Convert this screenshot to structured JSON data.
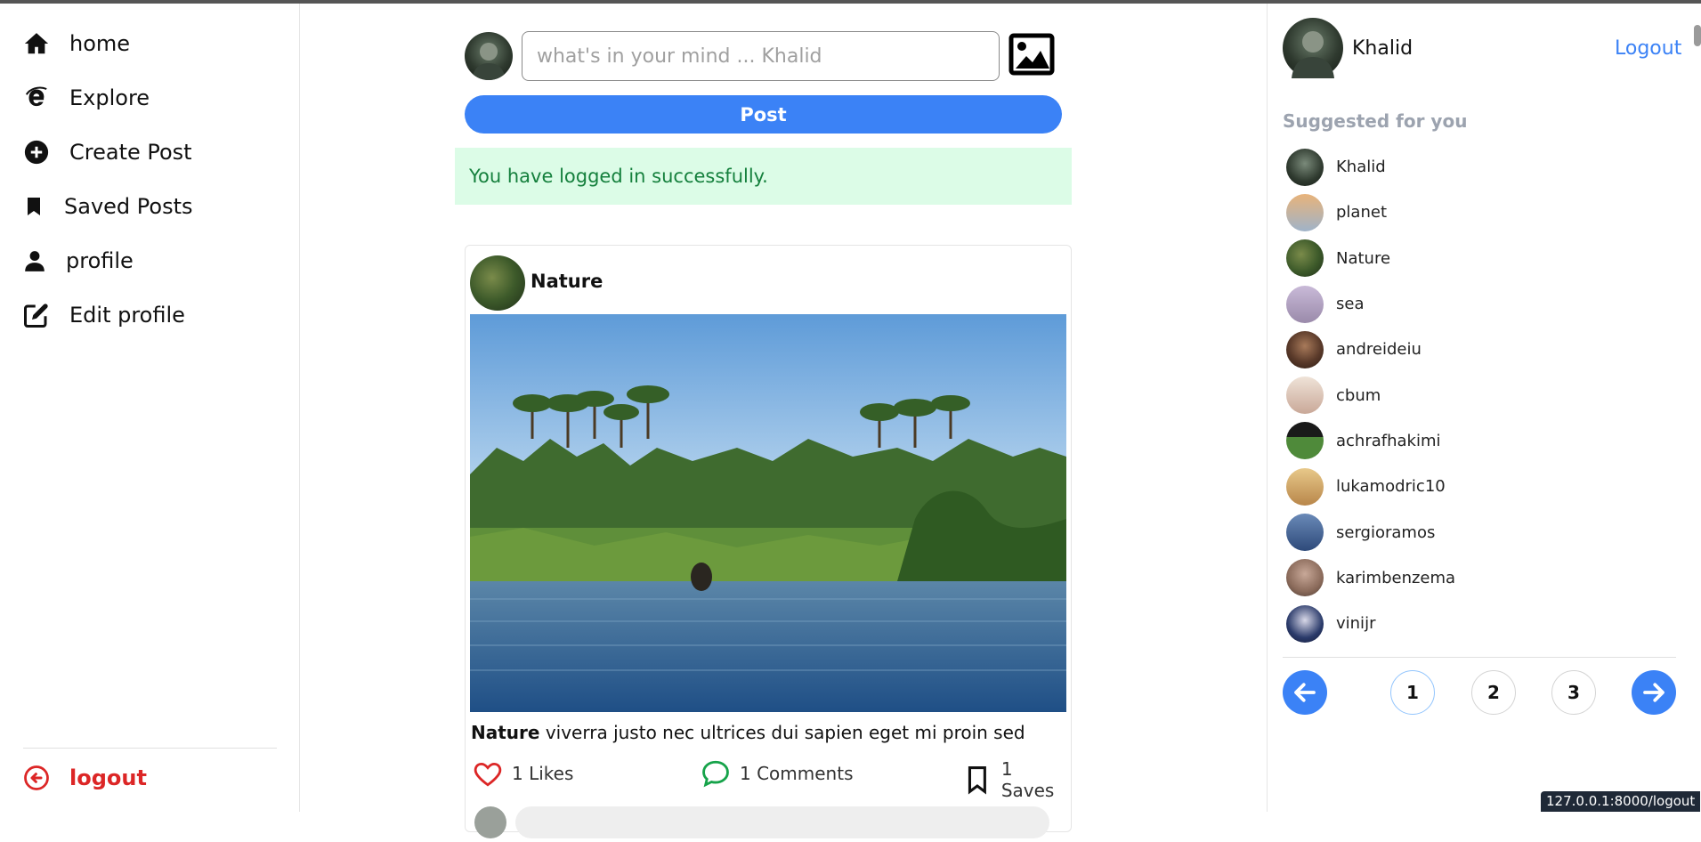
{
  "nav": {
    "items": [
      {
        "label": "home",
        "icon": "home-icon"
      },
      {
        "label": "Explore",
        "icon": "explore-icon"
      },
      {
        "label": "Create Post",
        "icon": "plus-circle-icon"
      },
      {
        "label": "Saved Posts",
        "icon": "bookmark-icon"
      },
      {
        "label": "profile",
        "icon": "user-icon"
      },
      {
        "label": "Edit profile",
        "icon": "edit-icon"
      }
    ],
    "logout_label": "logout"
  },
  "composer": {
    "placeholder": "what's in your mind ... Khalid",
    "post_label": "Post"
  },
  "alert": {
    "message": "You have logged in successfully."
  },
  "post": {
    "author": "Nature",
    "caption_author": "Nature",
    "caption_text": "viverra justo nec ultrices dui sapien eget mi proin sed",
    "likes_label": "1 Likes",
    "comments_label": "1 Comments",
    "saves_label": "1 Saves"
  },
  "current_user": {
    "name": "Khalid",
    "logout_label": "Logout"
  },
  "suggestions": {
    "title": "Suggested for you",
    "users": [
      {
        "name": "Khalid",
        "color": "#2f3a2f"
      },
      {
        "name": "planet",
        "color": "#d9a06b"
      },
      {
        "name": "Nature",
        "color": "#3d5a2a"
      },
      {
        "name": "sea",
        "color": "#b9a9c9"
      },
      {
        "name": "andreideiu",
        "color": "#5a3a2a"
      },
      {
        "name": "cbum",
        "color": "#d8c4b4"
      },
      {
        "name": "achrafhakimi",
        "color": "#3f6b2f"
      },
      {
        "name": "lukamodric10",
        "color": "#c9a66b"
      },
      {
        "name": "sergioramos",
        "color": "#2e4a7a"
      },
      {
        "name": "karimbenzema",
        "color": "#a88a7a"
      },
      {
        "name": "vinijr",
        "color": "#2a3a6a"
      }
    ]
  },
  "pagination": {
    "pages": [
      "1",
      "2",
      "3"
    ],
    "current": "1"
  },
  "colors": {
    "accent": "#3b82f6",
    "danger": "#dc2626",
    "success_bg": "#dcfce7",
    "success_text": "#15803d"
  },
  "status_bar": {
    "url": "127.0.0.1:8000/logout"
  }
}
